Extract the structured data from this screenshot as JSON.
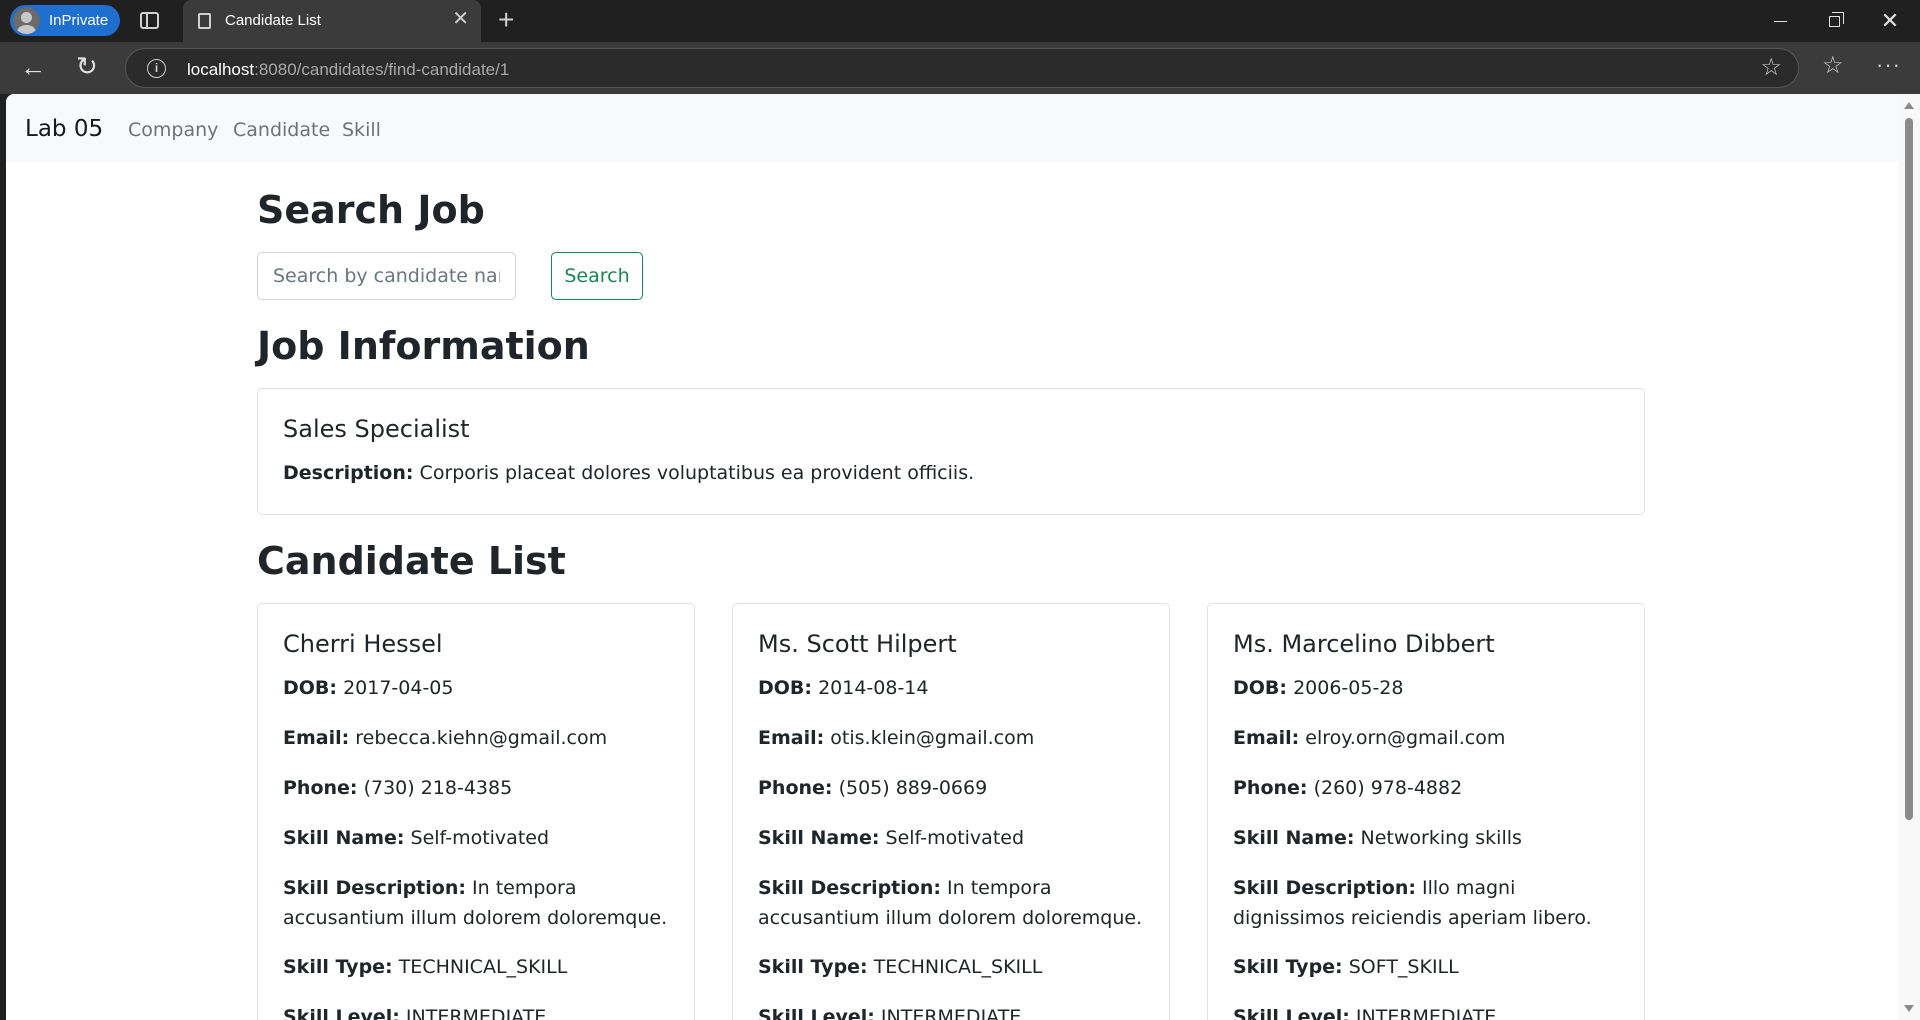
{
  "browser": {
    "profile_label": "InPrivate",
    "tab_title": "Candidate List",
    "url_host": "localhost",
    "url_rest": ":8080/candidates/find-candidate/1"
  },
  "navbar": {
    "brand": "Lab 05",
    "links": [
      "Company",
      "Candidate",
      "Skill"
    ]
  },
  "search": {
    "heading": "Search Job",
    "placeholder": "Search by candidate name",
    "button_label": "Search"
  },
  "job": {
    "heading": "Job Information",
    "title": "Sales Specialist",
    "description_label": "Description:",
    "description": "Corporis placeat dolores voluptatibus ea provident officiis."
  },
  "candidates_heading": "Candidate List",
  "field_labels": {
    "dob": "DOB:",
    "email": "Email:",
    "phone": "Phone:",
    "skill_name": "Skill Name:",
    "skill_description": "Skill Description:",
    "skill_type": "Skill Type:",
    "skill_level": "Skill Level:"
  },
  "candidates": [
    {
      "name": "Cherri Hessel",
      "dob": "2017-04-05",
      "email": "rebecca.kiehn@gmail.com",
      "phone": "(730) 218-4385",
      "skill_name": "Self-motivated",
      "skill_description": "In tempora accusantium illum dolorem doloremque.",
      "skill_type": "TECHNICAL_SKILL",
      "skill_level": "INTERMEDIATE"
    },
    {
      "name": "Ms. Scott Hilpert",
      "dob": "2014-08-14",
      "email": "otis.klein@gmail.com",
      "phone": "(505) 889-0669",
      "skill_name": "Self-motivated",
      "skill_description": "In tempora accusantium illum dolorem doloremque.",
      "skill_type": "TECHNICAL_SKILL",
      "skill_level": "INTERMEDIATE"
    },
    {
      "name": "Ms. Marcelino Dibbert",
      "dob": "2006-05-28",
      "email": "elroy.orn@gmail.com",
      "phone": "(260) 978-4882",
      "skill_name": "Networking skills",
      "skill_description": "Illo magni dignissimos reiciendis aperiam libero.",
      "skill_type": "SOFT_SKILL",
      "skill_level": "INTERMEDIATE"
    }
  ],
  "colors": {
    "accent_success": "#198754",
    "navbar_bg": "#f8f9fa",
    "profile_pill": "#1f6fd1"
  }
}
